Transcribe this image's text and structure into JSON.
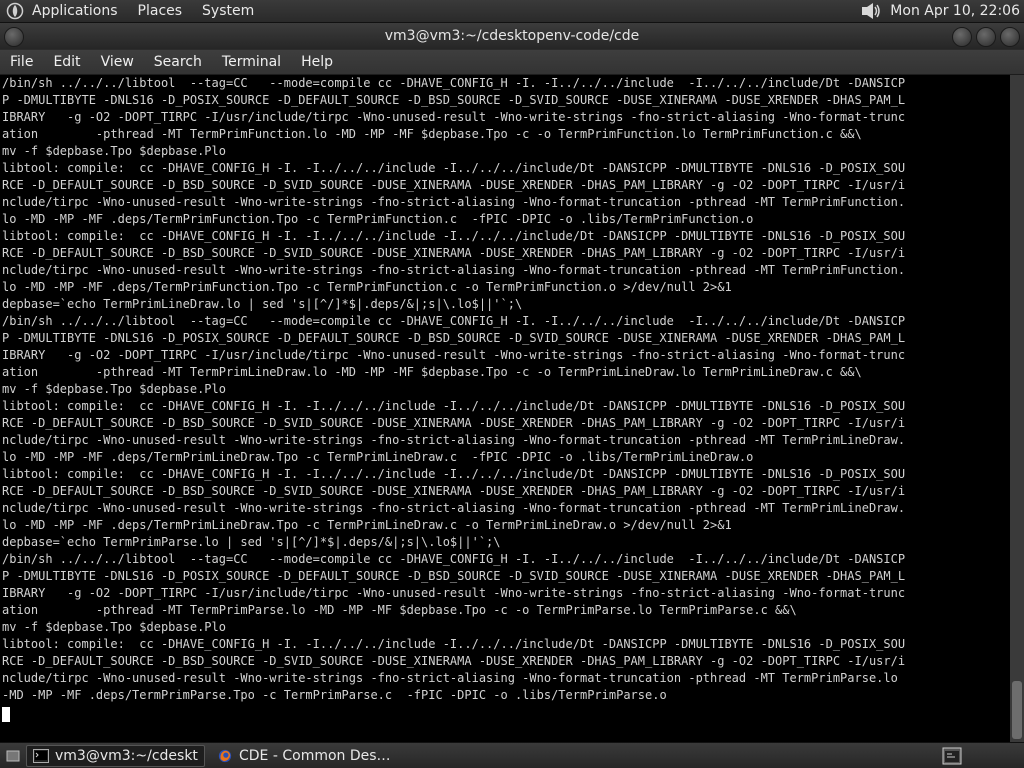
{
  "top_panel": {
    "menus": [
      "Applications",
      "Places",
      "System"
    ],
    "clock": "Mon Apr 10, 22:06"
  },
  "window": {
    "title": "vm3@vm3:~/cdesktopenv-code/cde"
  },
  "menubar": {
    "items": [
      "File",
      "Edit",
      "View",
      "Search",
      "Terminal",
      "Help"
    ]
  },
  "terminal": {
    "lines": [
      "/bin/sh ../../../libtool  --tag=CC   --mode=compile cc -DHAVE_CONFIG_H -I. -I../../../include  -I../../../include/Dt -DANSICP",
      "P -DMULTIBYTE -DNLS16 -D_POSIX_SOURCE -D_DEFAULT_SOURCE -D_BSD_SOURCE -D_SVID_SOURCE -DUSE_XINERAMA -DUSE_XRENDER -DHAS_PAM_L",
      "IBRARY   -g -O2 -DOPT_TIRPC -I/usr/include/tirpc -Wno-unused-result -Wno-write-strings -fno-strict-aliasing -Wno-format-trunc",
      "ation        -pthread -MT TermPrimFunction.lo -MD -MP -MF $depbase.Tpo -c -o TermPrimFunction.lo TermPrimFunction.c &&\\",
      "mv -f $depbase.Tpo $depbase.Plo",
      "libtool: compile:  cc -DHAVE_CONFIG_H -I. -I../../../include -I../../../include/Dt -DANSICPP -DMULTIBYTE -DNLS16 -D_POSIX_SOU",
      "RCE -D_DEFAULT_SOURCE -D_BSD_SOURCE -D_SVID_SOURCE -DUSE_XINERAMA -DUSE_XRENDER -DHAS_PAM_LIBRARY -g -O2 -DOPT_TIRPC -I/usr/i",
      "nclude/tirpc -Wno-unused-result -Wno-write-strings -fno-strict-aliasing -Wno-format-truncation -pthread -MT TermPrimFunction.",
      "lo -MD -MP -MF .deps/TermPrimFunction.Tpo -c TermPrimFunction.c  -fPIC -DPIC -o .libs/TermPrimFunction.o",
      "libtool: compile:  cc -DHAVE_CONFIG_H -I. -I../../../include -I../../../include/Dt -DANSICPP -DMULTIBYTE -DNLS16 -D_POSIX_SOU",
      "RCE -D_DEFAULT_SOURCE -D_BSD_SOURCE -D_SVID_SOURCE -DUSE_XINERAMA -DUSE_XRENDER -DHAS_PAM_LIBRARY -g -O2 -DOPT_TIRPC -I/usr/i",
      "nclude/tirpc -Wno-unused-result -Wno-write-strings -fno-strict-aliasing -Wno-format-truncation -pthread -MT TermPrimFunction.",
      "lo -MD -MP -MF .deps/TermPrimFunction.Tpo -c TermPrimFunction.c -o TermPrimFunction.o >/dev/null 2>&1",
      "depbase=`echo TermPrimLineDraw.lo | sed 's|[^/]*$|.deps/&|;s|\\.lo$||'`;\\",
      "/bin/sh ../../../libtool  --tag=CC   --mode=compile cc -DHAVE_CONFIG_H -I. -I../../../include  -I../../../include/Dt -DANSICP",
      "P -DMULTIBYTE -DNLS16 -D_POSIX_SOURCE -D_DEFAULT_SOURCE -D_BSD_SOURCE -D_SVID_SOURCE -DUSE_XINERAMA -DUSE_XRENDER -DHAS_PAM_L",
      "IBRARY   -g -O2 -DOPT_TIRPC -I/usr/include/tirpc -Wno-unused-result -Wno-write-strings -fno-strict-aliasing -Wno-format-trunc",
      "ation        -pthread -MT TermPrimLineDraw.lo -MD -MP -MF $depbase.Tpo -c -o TermPrimLineDraw.lo TermPrimLineDraw.c &&\\",
      "mv -f $depbase.Tpo $depbase.Plo",
      "libtool: compile:  cc -DHAVE_CONFIG_H -I. -I../../../include -I../../../include/Dt -DANSICPP -DMULTIBYTE -DNLS16 -D_POSIX_SOU",
      "RCE -D_DEFAULT_SOURCE -D_BSD_SOURCE -D_SVID_SOURCE -DUSE_XINERAMA -DUSE_XRENDER -DHAS_PAM_LIBRARY -g -O2 -DOPT_TIRPC -I/usr/i",
      "nclude/tirpc -Wno-unused-result -Wno-write-strings -fno-strict-aliasing -Wno-format-truncation -pthread -MT TermPrimLineDraw.",
      "lo -MD -MP -MF .deps/TermPrimLineDraw.Tpo -c TermPrimLineDraw.c  -fPIC -DPIC -o .libs/TermPrimLineDraw.o",
      "libtool: compile:  cc -DHAVE_CONFIG_H -I. -I../../../include -I../../../include/Dt -DANSICPP -DMULTIBYTE -DNLS16 -D_POSIX_SOU",
      "RCE -D_DEFAULT_SOURCE -D_BSD_SOURCE -D_SVID_SOURCE -DUSE_XINERAMA -DUSE_XRENDER -DHAS_PAM_LIBRARY -g -O2 -DOPT_TIRPC -I/usr/i",
      "nclude/tirpc -Wno-unused-result -Wno-write-strings -fno-strict-aliasing -Wno-format-truncation -pthread -MT TermPrimLineDraw.",
      "lo -MD -MP -MF .deps/TermPrimLineDraw.Tpo -c TermPrimLineDraw.c -o TermPrimLineDraw.o >/dev/null 2>&1",
      "depbase=`echo TermPrimParse.lo | sed 's|[^/]*$|.deps/&|;s|\\.lo$||'`;\\",
      "/bin/sh ../../../libtool  --tag=CC   --mode=compile cc -DHAVE_CONFIG_H -I. -I../../../include  -I../../../include/Dt -DANSICP",
      "P -DMULTIBYTE -DNLS16 -D_POSIX_SOURCE -D_DEFAULT_SOURCE -D_BSD_SOURCE -D_SVID_SOURCE -DUSE_XINERAMA -DUSE_XRENDER -DHAS_PAM_L",
      "IBRARY   -g -O2 -DOPT_TIRPC -I/usr/include/tirpc -Wno-unused-result -Wno-write-strings -fno-strict-aliasing -Wno-format-trunc",
      "ation        -pthread -MT TermPrimParse.lo -MD -MP -MF $depbase.Tpo -c -o TermPrimParse.lo TermPrimParse.c &&\\",
      "mv -f $depbase.Tpo $depbase.Plo",
      "libtool: compile:  cc -DHAVE_CONFIG_H -I. -I../../../include -I../../../include/Dt -DANSICPP -DMULTIBYTE -DNLS16 -D_POSIX_SOU",
      "RCE -D_DEFAULT_SOURCE -D_BSD_SOURCE -D_SVID_SOURCE -DUSE_XINERAMA -DUSE_XRENDER -DHAS_PAM_LIBRARY -g -O2 -DOPT_TIRPC -I/usr/i",
      "nclude/tirpc -Wno-unused-result -Wno-write-strings -fno-strict-aliasing -Wno-format-truncation -pthread -MT TermPrimParse.lo",
      "-MD -MP -MF .deps/TermPrimParse.Tpo -c TermPrimParse.c  -fPIC -DPIC -o .libs/TermPrimParse.o"
    ]
  },
  "taskbar": {
    "tasks": [
      {
        "label": "vm3@vm3:~/cdeskt…",
        "icon": "terminal-icon",
        "active": true
      },
      {
        "label": "CDE - Common Des…",
        "icon": "firefox-icon",
        "active": false
      }
    ]
  },
  "colors": {
    "terminal_bg": "#000000",
    "terminal_fg": "#d2d2d2",
    "panel_bg": "#2e2e2e"
  }
}
